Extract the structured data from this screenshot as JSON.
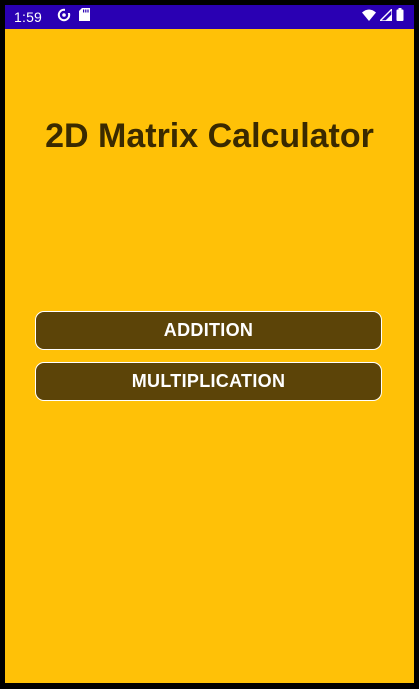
{
  "status_bar": {
    "time": "1:59",
    "background_color": "#2a00b3",
    "left_icons": [
      "sync-icon",
      "sd-card-icon"
    ],
    "right_icons": [
      "wifi-icon",
      "cell-signal-icon",
      "battery-icon"
    ]
  },
  "screen": {
    "background_color": "#ffc107",
    "title": "2D Matrix Calculator",
    "buttons": [
      {
        "label": "ADDITION"
      },
      {
        "label": "MULTIPLICATION"
      }
    ],
    "button_color": "#5c4408"
  }
}
